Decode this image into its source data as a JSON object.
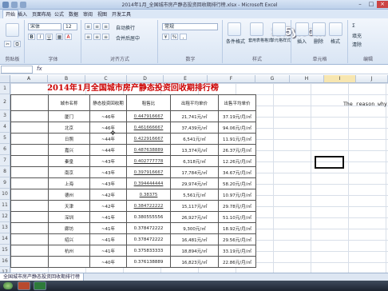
{
  "window": {
    "title": "2014年1月_全国城市房产静态投资回收期排行榜.xlsx - Microsoft Excel"
  },
  "watermark": "xx5y.com",
  "tabs": [
    "开始",
    "插入",
    "页面布局",
    "公式",
    "数据",
    "审阅",
    "视图",
    "开发工具"
  ],
  "ribbon": {
    "font_name": "宋体",
    "font_size": "12",
    "wrap_label": "自动换行",
    "merge_label": "合并后居中",
    "number_format": "常规",
    "styles": [
      "条件格式",
      "套用表格格式",
      "单元格样式"
    ],
    "cells": [
      "插入",
      "删除",
      "格式"
    ],
    "editing": [
      "填充",
      "清除"
    ],
    "group_labels": [
      "剪贴板",
      "字体",
      "对齐方式",
      "数字",
      "样式",
      "单元格",
      "编辑"
    ]
  },
  "formula_bar": {
    "fx": "fx"
  },
  "columns": [
    "A",
    "B",
    "C",
    "D",
    "E",
    "F",
    "G",
    "H",
    "I",
    "J"
  ],
  "rows": [
    "1",
    "2",
    "3",
    "4",
    "5",
    "6",
    "7",
    "8",
    "9",
    "10",
    "11",
    "12",
    "13",
    "14",
    "15",
    "16",
    "17"
  ],
  "sheet": {
    "title": "2014年1月全国城市房产静态投资回收期排行榜",
    "headers": [
      "城市名称",
      "静态投资回收期",
      "租售比",
      "出租平均单价",
      "出售平均单价"
    ],
    "rows": [
      [
        "厦门",
        "~46年",
        "0.447916667",
        "21,741元/㎡",
        "37.19元/月/㎡"
      ],
      [
        "北京",
        "~46年",
        "0.461666667",
        "37,439元/㎡",
        "94.06元/月/㎡"
      ],
      [
        "日照",
        "~44年",
        "0.422916667",
        "6,541元/㎡",
        "11.91元/月/㎡"
      ],
      [
        "嘉兴",
        "~44年",
        "0.487638889",
        "13,374元/㎡",
        "26.37元/月/㎡"
      ],
      [
        "秦皇",
        "~43年",
        "0.402777778",
        "6,318元/㎡",
        "12.26元/月/㎡"
      ],
      [
        "南京",
        "~43年",
        "0.397916667",
        "17,784元/㎡",
        "34.67元/月/㎡"
      ],
      [
        "上海",
        "~43年",
        "0.394444444",
        "29,974元/㎡",
        "58.20元/月/㎡"
      ],
      [
        "德州",
        "~42年",
        "0.38375",
        "5,561元/㎡",
        "10.97元/月/㎡"
      ],
      [
        "天津",
        "~42年",
        "0.384722222",
        "15,117元/㎡",
        "29.78元/月/㎡"
      ],
      [
        "深圳",
        "~41年",
        "0.380555556",
        "26,927元/㎡",
        "51.10元/月/㎡"
      ],
      [
        "廊坊",
        "~41年",
        "0.378472222",
        "9,300元/㎡",
        "18.92元/月/㎡"
      ],
      [
        "绍兴",
        "~41年",
        "0.378472222",
        "16,481元/㎡",
        "29.56元/月/㎡"
      ],
      [
        "杭州",
        "~41年",
        "0.375833333",
        "18,894元/㎡",
        "33.19元/月/㎡"
      ],
      [
        "",
        "~40年",
        "0.376138889",
        "16,823元/㎡",
        "22.86元/月/㎡"
      ]
    ]
  },
  "popup_text": "The reason why",
  "sheet_tab": "全国城市房产静态投资回收期排行榜",
  "taskbar": {
    "apps": [
      "Excel",
      "PPT"
    ]
  }
}
